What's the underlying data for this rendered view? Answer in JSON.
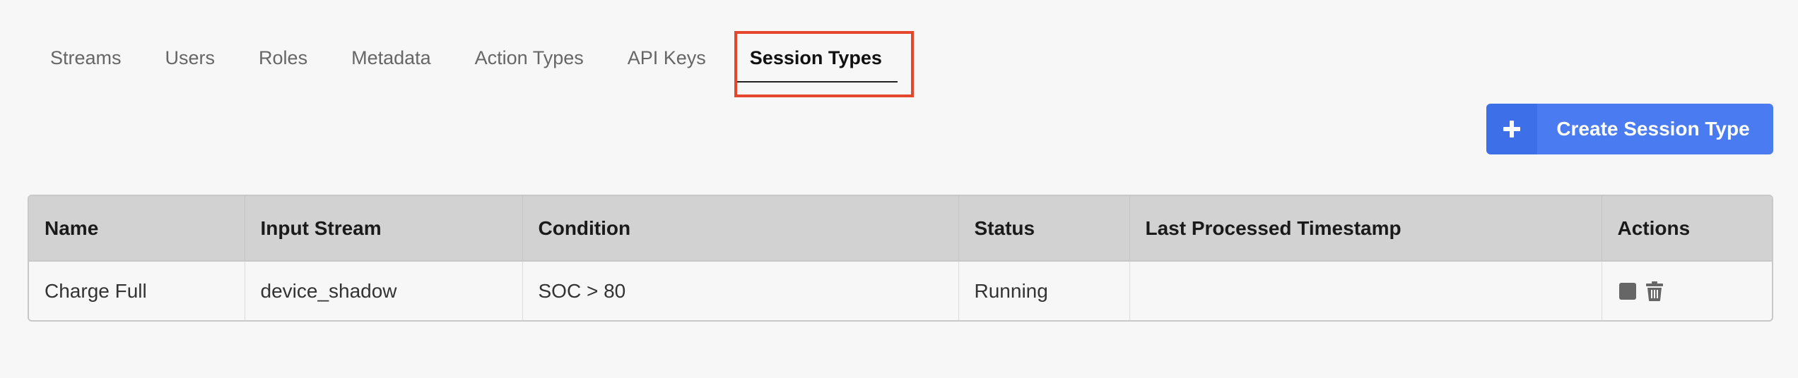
{
  "tabs": [
    {
      "label": "Streams",
      "active": false
    },
    {
      "label": "Users",
      "active": false
    },
    {
      "label": "Roles",
      "active": false
    },
    {
      "label": "Metadata",
      "active": false
    },
    {
      "label": "Action Types",
      "active": false
    },
    {
      "label": "API Keys",
      "active": false
    },
    {
      "label": "Session Types",
      "active": true
    }
  ],
  "create_button": {
    "label": "Create Session Type",
    "icon": "plus-icon"
  },
  "table": {
    "columns": [
      "Name",
      "Input Stream",
      "Condition",
      "Status",
      "Last Processed Timestamp",
      "Actions"
    ],
    "rows": [
      {
        "name": "Charge Full",
        "input_stream": "device_shadow",
        "condition": "SOC > 80",
        "status": "Running",
        "last_processed_timestamp": "",
        "actions": [
          "stop-icon",
          "trash-icon"
        ]
      }
    ]
  },
  "colors": {
    "accent": "#4a7bf0",
    "accent_dark": "#3d6fe8",
    "highlight": "#e4472c",
    "header_bg": "#d2d2d2",
    "icon_gray": "#666666"
  }
}
